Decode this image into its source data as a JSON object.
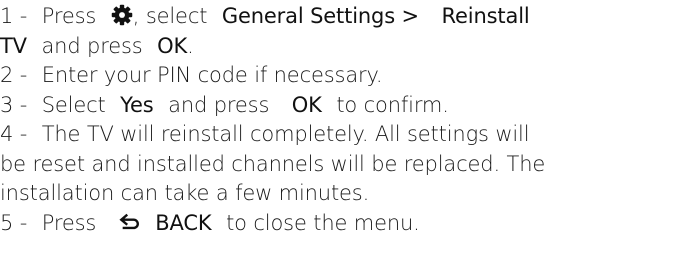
{
  "steps": [
    {
      "number": "1 -",
      "t1": "Press",
      "t2": ", select",
      "general_settings": "General Settings >",
      "reinstall": "Reinstall",
      "tv": "TV",
      "t3": "and press",
      "ok": "OK",
      "t4": "."
    },
    {
      "number": "2 -",
      "text": "Enter your PIN code if necessary."
    },
    {
      "number": "3 -",
      "t1": "Select",
      "yes": "Yes",
      "t2": "and press",
      "ok": "OK",
      "t3": "to confirm."
    },
    {
      "number": "4 -",
      "line1": "The TV will reinstall completely. All settings will",
      "line2": "be reset and installed channels will be replaced. The",
      "line3": "installation can take a few minutes."
    },
    {
      "number": "5 -",
      "t1": "Press",
      "back": "BACK",
      "t2": "to close the menu."
    }
  ],
  "icons": {
    "settings": "gear-icon",
    "back": "back-arrow-icon"
  }
}
